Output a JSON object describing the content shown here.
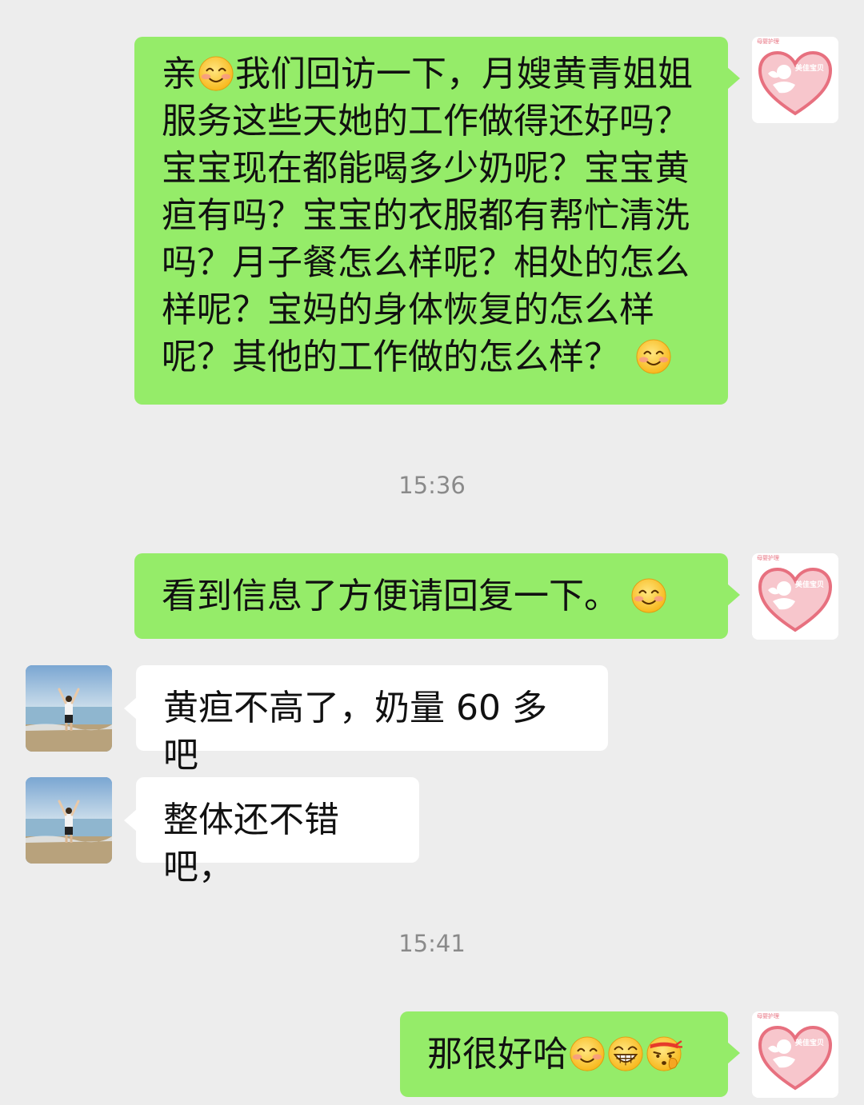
{
  "messages": [
    {
      "side": "outgoing",
      "text_part1": "亲",
      "emoji1": "smile-emoji",
      "text_part2": "我们回访一下，月嫂黄青姐姐服务这些天她的工作做得还好吗？宝宝现在都能喝多少奶呢？宝宝黄疸有吗？宝宝的衣服都有帮忙清洗吗？月子餐怎么样呢？相处的怎么样呢？宝妈的身体恢复的怎么样呢？其他的工作做的怎么样？",
      "emoji2": "smile-emoji"
    },
    {
      "side": "outgoing",
      "text": "看到信息了方便请回复一下。",
      "emoji": "smile-emoji"
    },
    {
      "side": "incoming",
      "text": "黄疸不高了，奶量 60 多吧"
    },
    {
      "side": "incoming",
      "text": "整体还不错吧，"
    },
    {
      "side": "outgoing",
      "text": "那很好哈",
      "emojis": [
        "smile-emoji",
        "grin-emoji",
        "shush-emoji"
      ]
    }
  ],
  "timestamps": [
    "15:36",
    "15:41"
  ],
  "avatars": {
    "self": {
      "icon": "heart-angel-logo-icon",
      "logo_top_text": "母婴护理",
      "logo_inner_text": "美佳宝贝"
    },
    "other": {
      "icon": "beach-person-photo"
    }
  },
  "colors": {
    "background": "#ededed",
    "outgoing_bubble": "#95ec69",
    "incoming_bubble": "#ffffff",
    "timestamp_text": "#8a8a8a",
    "logo_heart": "#e7707f"
  }
}
